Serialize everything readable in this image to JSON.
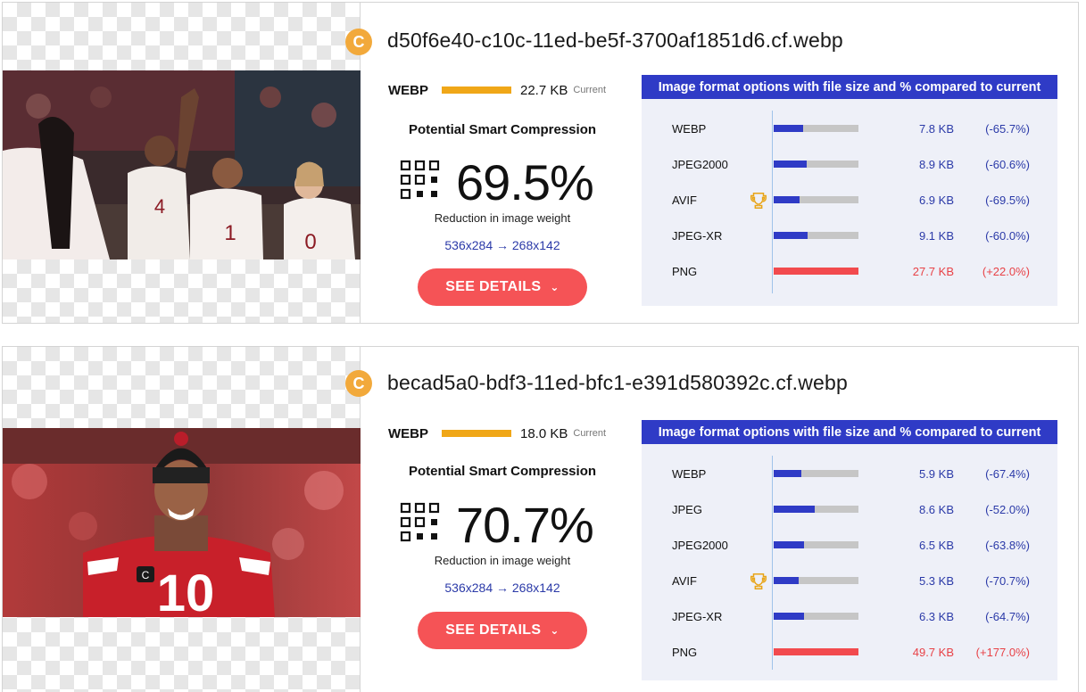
{
  "colors": {
    "accent_orange": "#f0a718",
    "badge": "#f2a93b",
    "button": "#f55356",
    "header_blue": "#2f3bc6",
    "value_blue": "#2b3aa8",
    "worse_red": "#e84247"
  },
  "cards": [
    {
      "badge": "C",
      "filename": "d50f6e40-c10c-11ed-be5f-3700af1851d6.cf.webp",
      "current": {
        "format": "WEBP",
        "size": "22.7 KB",
        "label": "Current"
      },
      "compression_title": "Potential Smart Compression",
      "percent": "69.5%",
      "reduction_label": "Reduction in image weight",
      "dimensions": "536x284 → 268x142",
      "details_label": "SEE DETAILS",
      "options_title": "Image format options with file size and % compared to current",
      "options": [
        {
          "name": "WEBP",
          "size": "7.8 KB",
          "pct": "(-65.7%)",
          "fill": 0.343,
          "best": false,
          "worse": false
        },
        {
          "name": "JPEG2000",
          "size": "8.9 KB",
          "pct": "(-60.6%)",
          "fill": 0.394,
          "best": false,
          "worse": false
        },
        {
          "name": "AVIF",
          "size": "6.9 KB",
          "pct": "(-69.5%)",
          "fill": 0.305,
          "best": true,
          "worse": false
        },
        {
          "name": "JPEG-XR",
          "size": "9.1 KB",
          "pct": "(-60.0%)",
          "fill": 0.4,
          "best": false,
          "worse": false
        },
        {
          "name": "PNG",
          "size": "27.7 KB",
          "pct": "(+22.0%)",
          "fill": 1.0,
          "best": false,
          "worse": true
        }
      ]
    },
    {
      "badge": "C",
      "filename": "becad5a0-bdf3-11ed-bfc1-e391d580392c.cf.webp",
      "current": {
        "format": "WEBP",
        "size": "18.0 KB",
        "label": "Current"
      },
      "compression_title": "Potential Smart Compression",
      "percent": "70.7%",
      "reduction_label": "Reduction in image weight",
      "dimensions": "536x284 → 268x142",
      "details_label": "SEE DETAILS",
      "options_title": "Image format options with file size and % compared to current",
      "options": [
        {
          "name": "WEBP",
          "size": "5.9 KB",
          "pct": "(-67.4%)",
          "fill": 0.326,
          "best": false,
          "worse": false
        },
        {
          "name": "JPEG",
          "size": "8.6 KB",
          "pct": "(-52.0%)",
          "fill": 0.48,
          "best": false,
          "worse": false
        },
        {
          "name": "JPEG2000",
          "size": "6.5 KB",
          "pct": "(-63.8%)",
          "fill": 0.362,
          "best": false,
          "worse": false
        },
        {
          "name": "AVIF",
          "size": "5.3 KB",
          "pct": "(-70.7%)",
          "fill": 0.293,
          "best": true,
          "worse": false
        },
        {
          "name": "JPEG-XR",
          "size": "6.3 KB",
          "pct": "(-64.7%)",
          "fill": 0.353,
          "best": false,
          "worse": false
        },
        {
          "name": "PNG",
          "size": "49.7 KB",
          "pct": "(+177.0%)",
          "fill": 1.0,
          "best": false,
          "worse": true
        }
      ]
    }
  ]
}
